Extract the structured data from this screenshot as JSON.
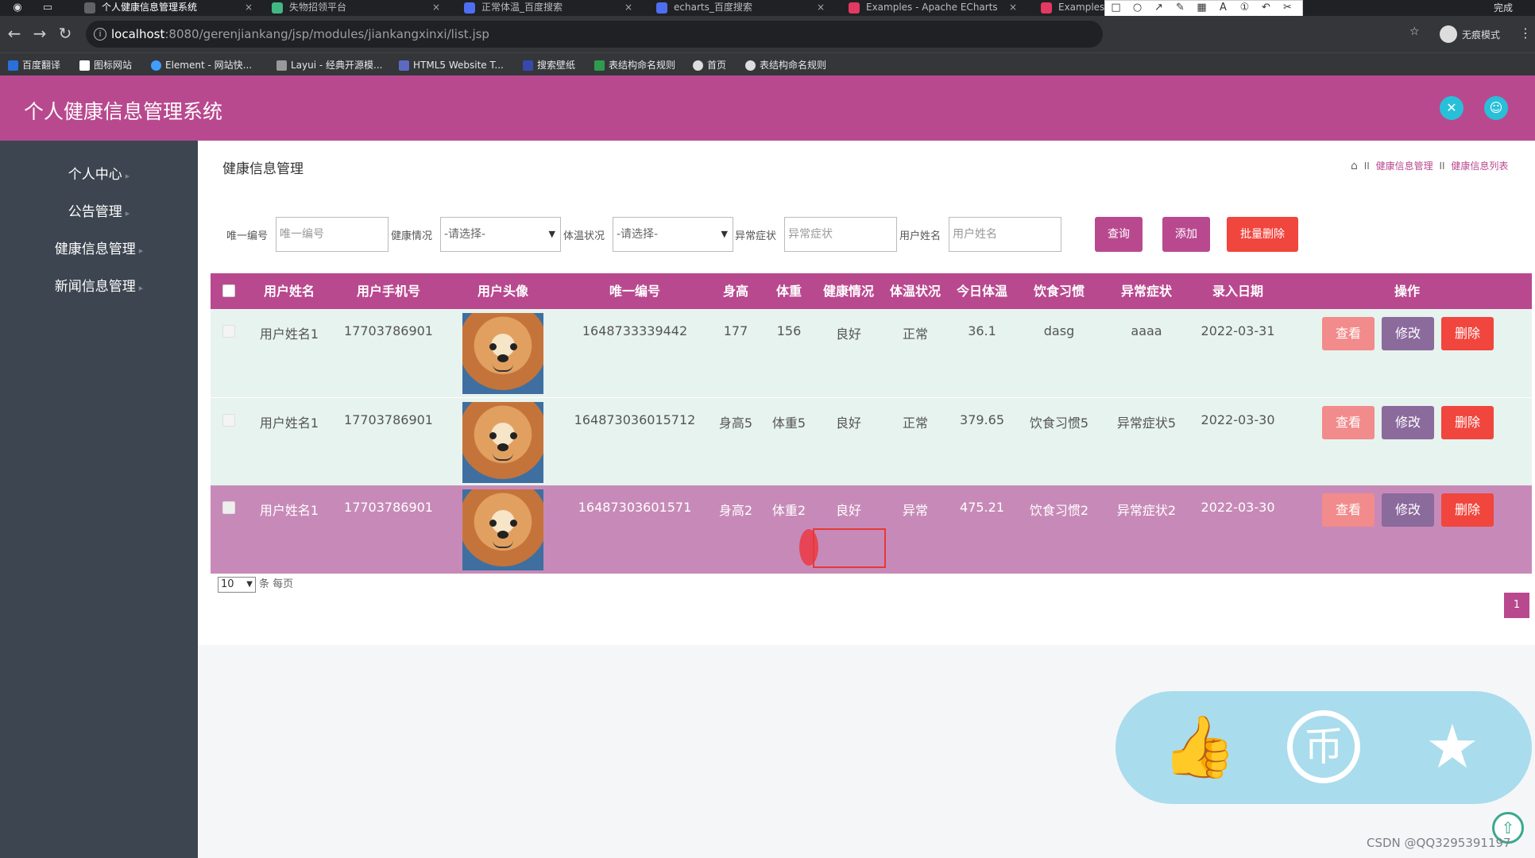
{
  "browser": {
    "tabs": [
      {
        "label": "个人健康信息管理系统",
        "color": "#5f6368"
      },
      {
        "label": "失物招领平台",
        "color": "#41b883"
      },
      {
        "label": "正常体温_百度搜索",
        "color": "#4e6ef2"
      },
      {
        "label": "echarts_百度搜索",
        "color": "#4e6ef2"
      },
      {
        "label": "Examples - Apache ECharts",
        "color": "#e43961"
      },
      {
        "label": "Examples",
        "color": "#e43961"
      }
    ],
    "url_host": "localhost",
    "url_path": ":8080/gerenjiankang/jsp/modules/jiankangxinxi/list.jsp",
    "incognito_label": "无痕模式",
    "done_label": "完成",
    "bookmarks": [
      "百度翻译",
      "图标网站",
      "Element - 网站快...",
      "Layui - 经典开源模...",
      "HTML5 Website T...",
      "搜索壁纸",
      "表结构命名规则",
      "首页",
      "表结构命名规则"
    ],
    "draw_toolbar": {
      "font_size": "20",
      "current_color": "#e53935"
    }
  },
  "app": {
    "title": "个人健康信息管理系统",
    "accent": "#b9498f",
    "sidebar": [
      "个人中心",
      "公告管理",
      "健康信息管理",
      "新闻信息管理"
    ]
  },
  "page": {
    "title": "健康信息管理",
    "breadcrumb": [
      "健康信息管理",
      "健康信息列表"
    ]
  },
  "search": {
    "uid_label": "唯一编号",
    "uid_placeholder": "唯一编号",
    "health_label": "健康情况",
    "health_value": "-请选择-",
    "temp_label": "体温状况",
    "temp_value": "-请选择-",
    "symptom_label": "异常症状",
    "symptom_placeholder": "异常症状",
    "name_label": "用户姓名",
    "name_placeholder": "用户姓名",
    "query_btn": "查询",
    "add_btn": "添加",
    "batch_delete_btn": "批量删除"
  },
  "table": {
    "headers": [
      "用户姓名",
      "用户手机号",
      "用户头像",
      "唯一编号",
      "身高",
      "体重",
      "健康情况",
      "体温状况",
      "今日体温",
      "饮食习惯",
      "异常症状",
      "录入日期",
      "操作"
    ],
    "rows": [
      {
        "name": "用户姓名1",
        "phone": "17703786901",
        "uid": "1648733339442",
        "height": "177",
        "weight": "156",
        "health": "良好",
        "temp_status": "正常",
        "temp": "36.1",
        "diet": "dasg",
        "symptom": "aaaa",
        "date": "2022-03-31"
      },
      {
        "name": "用户姓名1",
        "phone": "17703786901",
        "uid": "164873036015712",
        "height": "身高5",
        "weight": "体重5",
        "health": "良好",
        "temp_status": "正常",
        "temp": "379.65",
        "diet": "饮食习惯5",
        "symptom": "异常症状5",
        "date": "2022-03-30"
      },
      {
        "name": "用户姓名1",
        "phone": "17703786901",
        "uid": "16487303601571",
        "height": "身高2",
        "weight": "体重2",
        "health": "良好",
        "temp_status": "异常",
        "temp": "475.21",
        "diet": "饮食习惯2",
        "symptom": "异常症状2",
        "date": "2022-03-30"
      }
    ],
    "view_btn": "查看",
    "edit_btn": "修改",
    "delete_btn": "删除"
  },
  "pagination": {
    "page_size": "10",
    "per_page_label": "条 每页",
    "current_page": "1"
  },
  "watermark": "CSDN @QQ3295391197"
}
